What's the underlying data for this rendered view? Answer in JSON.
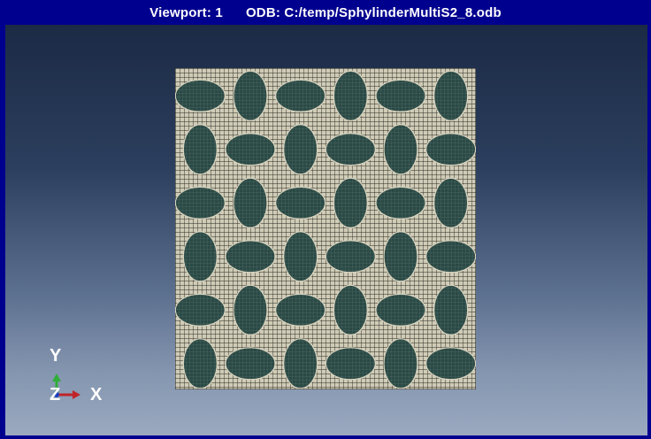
{
  "window": {
    "viewport_label": "Viewport: 1",
    "odb_label": "ODB: C:/temp/SphylinderMultiS2_8.odb"
  },
  "colors": {
    "title_bar": "#00008f",
    "matrix_mesh": "#cfcbb6",
    "inclusion_fill": "#2c4a45",
    "x_axis": "#c0242a",
    "y_axis": "#2fae3a",
    "z_axis": "#1f3fbf"
  },
  "triad": {
    "y_label": "Y",
    "z_label": "Z",
    "x_label": "X"
  },
  "model": {
    "description_icon": "fe-mesh",
    "inclusions": {
      "rows": 6,
      "cols": 6,
      "orientation_grid": [
        [
          "h",
          "v",
          "h",
          "v",
          "h",
          "v"
        ],
        [
          "v",
          "h",
          "v",
          "h",
          "v",
          "h"
        ],
        [
          "h",
          "v",
          "h",
          "v",
          "h",
          "v"
        ],
        [
          "v",
          "h",
          "v",
          "h",
          "v",
          "h"
        ],
        [
          "h",
          "v",
          "h",
          "v",
          "h",
          "v"
        ],
        [
          "v",
          "h",
          "v",
          "h",
          "v",
          "h"
        ]
      ]
    }
  }
}
